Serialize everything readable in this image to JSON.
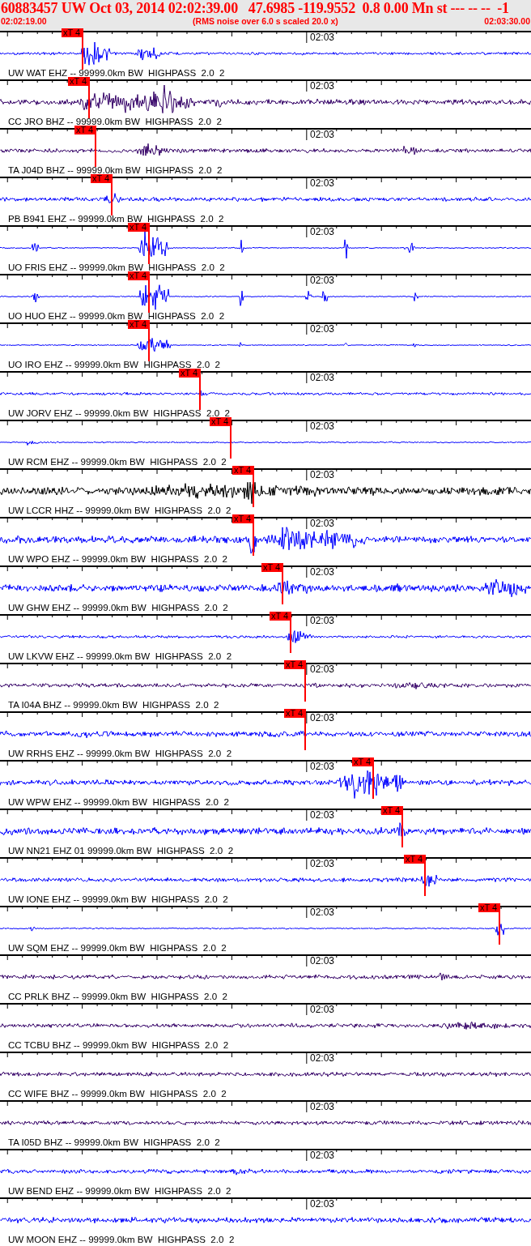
{
  "header": {
    "title": "60883457 UW Oct 03, 2014 02:02:39.00   47.6985 -119.9552  0.8 0.00 Mn st --- -- --  -1",
    "start_time": "02:02:19.00",
    "note": "(RMS noise over 6.0 s scaled 20.0 x)",
    "end_time": "02:03:30.00"
  },
  "traces": [
    {
      "label": "UW WAT EHZ -- 99999.0km BW  HIGHPASS  2.0  2",
      "time_label": "02:03",
      "color": "#0000ff",
      "pick": "xT 4"
    },
    {
      "label": "CC JRO BHZ -- 99999.0km BW  HIGHPASS  2.0  2",
      "time_label": "02:03",
      "color": "#330066",
      "pick": "xT 4"
    },
    {
      "label": "TA J04D BHZ -- 99999.0km BW  HIGHPASS  2.0  2",
      "time_label": "02:03",
      "color": "#330066",
      "pick": "xT 4"
    },
    {
      "label": "PB B941 EHZ -- 99999.0km BW  HIGHPASS  2.0  2",
      "time_label": "02:03",
      "color": "#0000ff",
      "pick": "xT 4"
    },
    {
      "label": "UO FRIS EHZ -- 99999.0km BW  HIGHPASS  2.0  2",
      "time_label": "02:03",
      "color": "#0000ff",
      "pick": "xT 4"
    },
    {
      "label": "UO HUO EHZ -- 99999.0km BW  HIGHPASS  2.0  2",
      "time_label": "02:03",
      "color": "#0000ff",
      "pick": "xT 4"
    },
    {
      "label": "UO IRO EHZ -- 99999.0km BW  HIGHPASS  2.0  2",
      "time_label": "02:03",
      "color": "#0000ff",
      "pick": "xT 4"
    },
    {
      "label": "UW JORV EHZ -- 99999.0km BW  HIGHPASS  2.0  2",
      "time_label": "02:03",
      "color": "#0000ff",
      "pick": "xT 4"
    },
    {
      "label": "UW RCM EHZ -- 99999.0km BW  HIGHPASS  2.0  2",
      "time_label": "02:03",
      "color": "#0000ff",
      "pick": "xT 4"
    },
    {
      "label": "UW LCCR HHZ -- 99999.0km BW  HIGHPASS  2.0  2",
      "time_label": "02:03",
      "color": "#000000",
      "pick": "xT 4"
    },
    {
      "label": "UW WPO EHZ -- 99999.0km BW  HIGHPASS  2.0  2",
      "time_label": "02:03",
      "color": "#0000ff",
      "pick": "xT 4"
    },
    {
      "label": "UW GHW EHZ -- 99999.0km BW  HIGHPASS  2.0  2",
      "time_label": "02:03",
      "color": "#0000ff",
      "pick": "xT 4"
    },
    {
      "label": "UW LKVW EHZ -- 99999.0km BW  HIGHPASS  2.0  2",
      "time_label": "02:03",
      "color": "#0000ff",
      "pick": "xT 4"
    },
    {
      "label": "TA I04A BHZ -- 99999.0km BW  HIGHPASS  2.0  2",
      "time_label": "02:03",
      "color": "#330066",
      "pick": "xT 4"
    },
    {
      "label": "UW RRHS EHZ -- 99999.0km BW  HIGHPASS  2.0  2",
      "time_label": "02:03",
      "color": "#0000ff",
      "pick": "xT 4"
    },
    {
      "label": "UW WPW EHZ -- 99999.0km BW  HIGHPASS  2.0  2",
      "time_label": "02:03",
      "color": "#0000ff",
      "pick": "xT 4"
    },
    {
      "label": "UW NN21 EHZ 01 99999.0km BW  HIGHPASS  2.0  2",
      "time_label": "02:03",
      "color": "#0000ff",
      "pick": "xT 4"
    },
    {
      "label": "UW IONE EHZ -- 99999.0km BW  HIGHPASS  2.0  2",
      "time_label": "02:03",
      "color": "#0000ff",
      "pick": "xT 4"
    },
    {
      "label": "UW SQM EHZ -- 99999.0km BW  HIGHPASS  2.0  2",
      "time_label": "02:03",
      "color": "#0000ff",
      "pick": "xT 4"
    },
    {
      "label": "CC PRLK BHZ -- 99999.0km BW  HIGHPASS  2.0  2",
      "time_label": "02:03",
      "color": "#330066"
    },
    {
      "label": "CC TCBU BHZ -- 99999.0km BW  HIGHPASS  2.0  2",
      "time_label": "02:03",
      "color": "#330066"
    },
    {
      "label": "CC WIFE BHZ -- 99999.0km BW  HIGHPASS  2.0  2",
      "time_label": "02:03",
      "color": "#330066"
    },
    {
      "label": "TA I05D BHZ -- 99999.0km BW  HIGHPASS  2.0  2",
      "time_label": "02:03",
      "color": "#330066"
    },
    {
      "label": "UW BEND EHZ -- 99999.0km BW  HIGHPASS  2.0  2",
      "time_label": "02:03",
      "color": "#0000ff"
    },
    {
      "label": "UW MOON EHZ -- 99999.0km BW  HIGHPASS  2.0  2",
      "time_label": "02:03",
      "color": "#0000ff"
    }
  ]
}
